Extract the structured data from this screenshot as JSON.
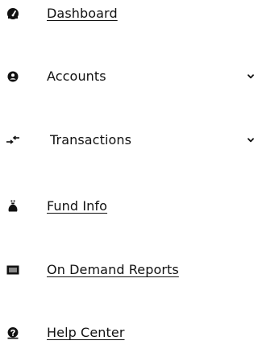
{
  "nav": {
    "items": [
      {
        "label": "Dashboard",
        "icon": "dashboard-gauge-icon",
        "link": true
      },
      {
        "label": "Accounts",
        "icon": "user-circle-icon",
        "expandable": true
      },
      {
        "label": "Transactions",
        "icon": "exchange-arrows-icon",
        "expandable": true
      },
      {
        "label": "Fund Info",
        "icon": "money-bag-icon",
        "link": true
      },
      {
        "label": "On Demand Reports",
        "icon": "report-document-icon",
        "link": true
      },
      {
        "label": "Help Center",
        "icon": "help-icon",
        "link": true
      }
    ]
  },
  "colors": {
    "text": "#111111",
    "icon": "#111111",
    "background": "#ffffff"
  }
}
